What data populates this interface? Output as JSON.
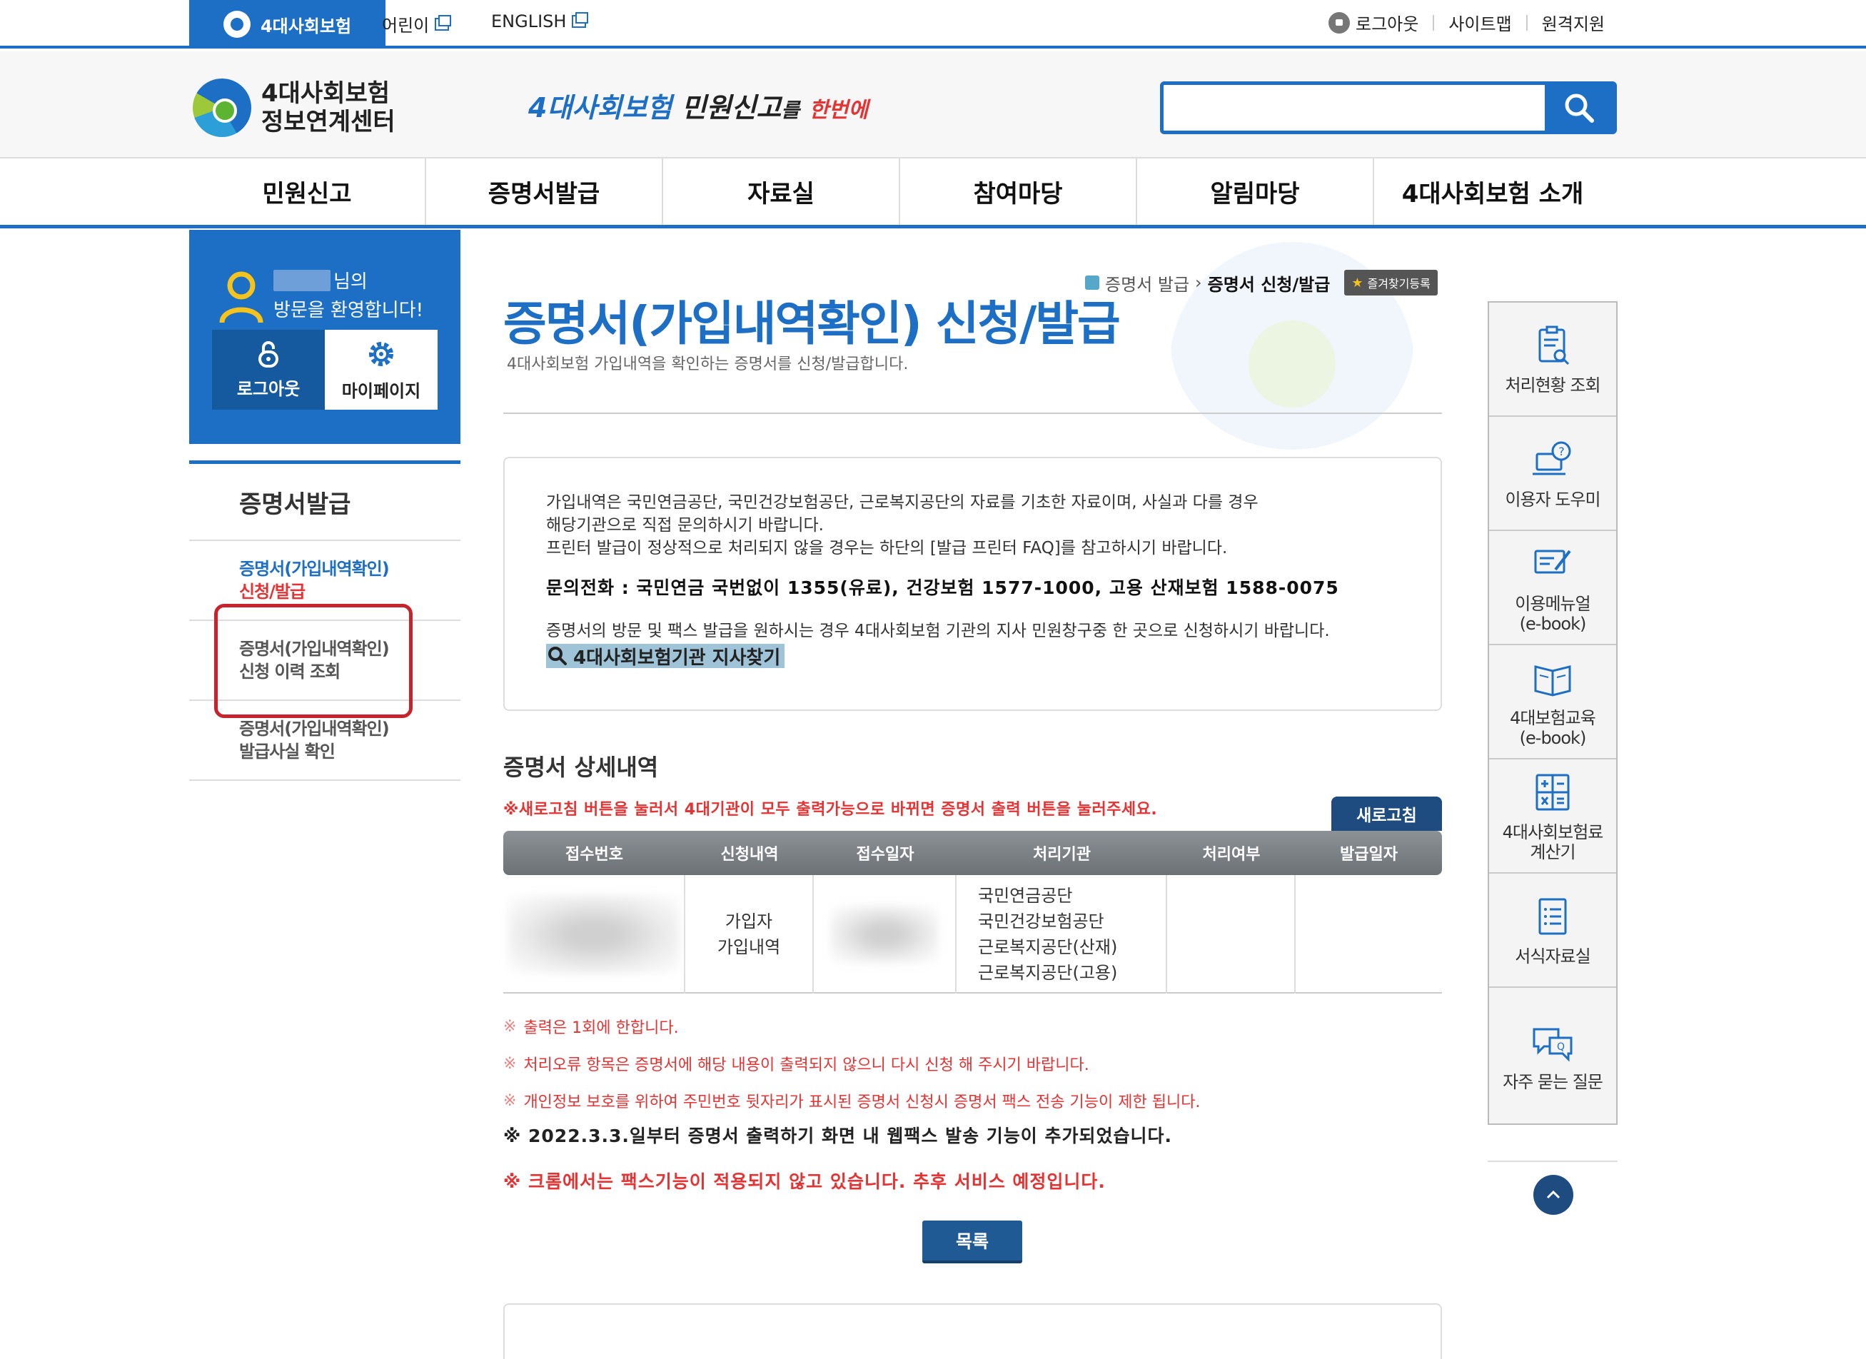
{
  "topbar": {
    "home_tab": "4대사회보험",
    "kids": "어린이",
    "english": "ENGLISH",
    "logout": "로그아웃",
    "sitemap": "사이트맵",
    "remote": "원격지원"
  },
  "header": {
    "brand_line1": "4대사회보험",
    "brand_line2": "정보연계센터",
    "slogan_blue": "4대사회보험",
    "slogan_black": "민원신고",
    "slogan_suffix": "를",
    "slogan_red": "한번에",
    "search_value": ""
  },
  "gnb": [
    "민원신고",
    "증명서발급",
    "자료실",
    "참여마당",
    "알림마당",
    "4대사회보험 소개"
  ],
  "welcome": {
    "nim": "님의",
    "greeting": "방문을 환영합니다!",
    "logout": "로그아웃",
    "mypage": "마이페이지"
  },
  "lnb": {
    "title": "증명서발급",
    "item1_line1": "증명서(가입내역확인)",
    "item1_line2": "신청/발급",
    "item2_line1": "증명서(가입내역확인)",
    "item2_line2": "신청 이력 조회",
    "item3_line1": "증명서(가입내역확인)",
    "item3_line2": "발급사실 확인"
  },
  "breadcrumb": {
    "parent": "증명서 발급",
    "current": "증명서 신청/발급",
    "fav": "즐겨찾기등록"
  },
  "page": {
    "title": "증명서(가입내역확인) 신청/발급",
    "desc": "4대사회보험 가입내역을 확인하는 증명서를 신청/발급합니다."
  },
  "notice": {
    "line1": "가입내역은 국민연금공단, 국민건강보험공단, 근로복지공단의 자료를 기초한 자료이며, 사실과 다를 경우",
    "line2": "해당기관으로 직접 문의하시기 바랍니다.",
    "line3": "프린터 발급이 정상적으로 처리되지 않을 경우는 하단의 [발급 프린터 FAQ]를 참고하시기 바랍니다.",
    "phone": "문의전화 : 국민연금 국번없이 1355(유료), 건강보험 1577-1000, 고용 산재보험 1588-0075",
    "visit": "증명서의 방문 및 팩스 발급을 원하시는 경우 4대사회보험 기관의 지사 민원창구중 한 곳으로 신청하시기 바랍니다.",
    "branch_link": "4대사회보험기관 지사찾기"
  },
  "detail": {
    "title": "증명서 상세내역",
    "refresh_note": "※새로고침 버튼을 눌러서 4대기관이 모두 출력가능으로 바뀌면 증명서 출력 버튼을 눌러주세요.",
    "refresh_btn": "새로고침",
    "columns": [
      "접수번호",
      "신청내역",
      "접수일자",
      "처리기관",
      "처리여부",
      "발급일자"
    ],
    "row": {
      "request_line1": "가입자",
      "request_line2": "가입내역",
      "agency1": "국민연금공단",
      "agency2": "국민건강보험공단",
      "agency3": "근로복지공단(산재)",
      "agency4": "근로복지공단(고용)"
    }
  },
  "warnings": {
    "w1": "출력은 1회에 한합니다.",
    "w2": "처리오류 항목은 증명서에 해당 내용이 출력되지 않으니 다시 신청 해 주시기 바랍니다.",
    "w3": "개인정보 보호를 위하여 주민번호 뒷자리가 표시된 증명서 신청시 증명서 팩스 전송 기능이 제한 됩니다.",
    "fax1": "※ 2022.3.3.일부터 증명서 출력하기 화면 내 웹팩스 발송 기능이 추가되었습니다.",
    "fax2": "※ 크롬에서는 팩스기능이 적용되지 않고 있습니다. 추후 서비스 예정입니다.",
    "list_btn": "목록"
  },
  "quick": {
    "q1": "처리현황 조회",
    "q2": "이용자 도우미",
    "q3_line1": "이용메뉴얼",
    "q3_line2": "(e-book)",
    "q4_line1": "4대보험교육",
    "q4_line2": "(e-book)",
    "q5_line1": "4대사회보험료",
    "q5_line2": "계산기",
    "q6": "서식자료실",
    "q7": "자주 묻는 질문"
  },
  "colors": {
    "primary": "#1c6fc4",
    "dark_navy": "#1f4c80",
    "alert_red": "#e53334",
    "highlight": "#c8232c"
  }
}
